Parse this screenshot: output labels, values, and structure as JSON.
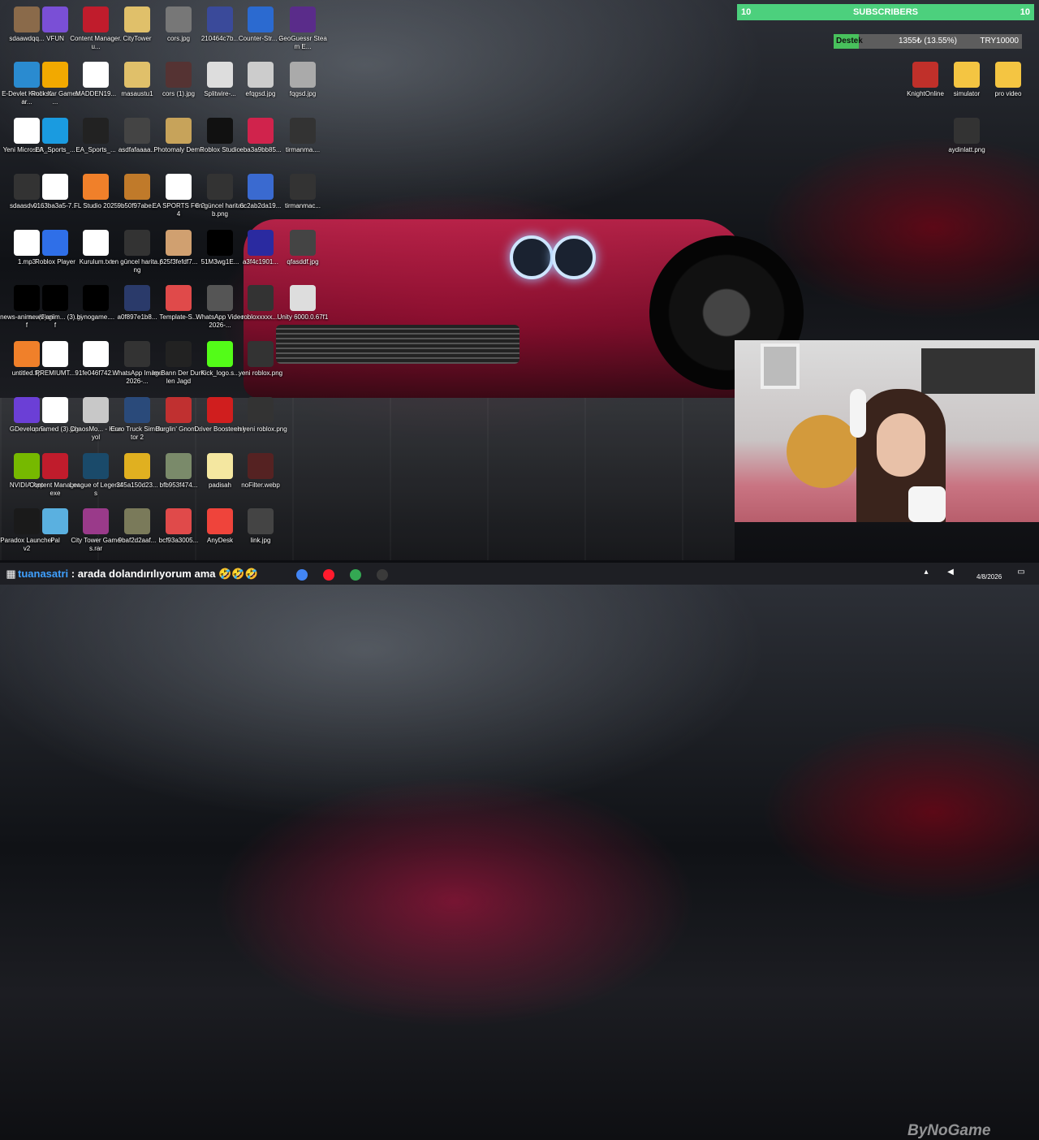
{
  "desktop": {
    "icons": [
      {
        "label": "sdaawdqq...",
        "icon": "image-thumb-icon",
        "color": "#8a6a4a"
      },
      {
        "label": "VFUN",
        "icon": "vfun-cubes-icon",
        "color": "#7a4fd6"
      },
      {
        "label": "Content Manager.u...",
        "icon": "content-manager-icon",
        "color": "#c01c2c"
      },
      {
        "label": "CityTower",
        "icon": "folder-zip-icon",
        "color": "#e0c06a"
      },
      {
        "label": "cors.jpg",
        "icon": "image-thumb-icon",
        "color": "#777777"
      },
      {
        "label": "210464c7b...",
        "icon": "image-thumb-icon",
        "color": "#3a4a9a"
      },
      {
        "label": "Counter-Str... 2",
        "icon": "counter-strike-icon",
        "color": "#2b6ad0"
      },
      {
        "label": "GeoGuessr Steam E...",
        "icon": "geoguessr-pin-icon",
        "color": "#5a2c8a"
      },
      {
        "label": "E-Devlet Kimlik Kar...",
        "icon": "edevlet-icon",
        "color": "#2a8bd0"
      },
      {
        "label": "Rockstar Games ...",
        "icon": "rockstar-icon",
        "color": "#f2a900"
      },
      {
        "label": "MADDEN19...",
        "icon": "image-file-icon",
        "color": "#ffffff"
      },
      {
        "label": "masaustu1",
        "icon": "folder-zip-icon",
        "color": "#e0c06a"
      },
      {
        "label": "cors (1).jpg",
        "icon": "image-thumb-icon",
        "color": "#553333"
      },
      {
        "label": "Splitwire-...",
        "icon": "splitwire-icon",
        "color": "#dddddd"
      },
      {
        "label": "efqgsd.jpg",
        "icon": "image-thumb-icon",
        "color": "#cccccc"
      },
      {
        "label": "fqgsd.jpg",
        "icon": "image-thumb-icon",
        "color": "#aaaaaa"
      },
      {
        "label": "Yeni Microsoft ...",
        "icon": "docx-file-icon",
        "color": "#ffffff"
      },
      {
        "label": "EA_Sports_...",
        "icon": "edge-browser-icon",
        "color": "#1a9be0"
      },
      {
        "label": "EA_Sports_...",
        "icon": "ea-sports-icon",
        "color": "#222222"
      },
      {
        "label": "asdfafaaaa...",
        "icon": "image-thumb-icon",
        "color": "#444444"
      },
      {
        "label": "Photomaly Demo",
        "icon": "photomaly-icon",
        "color": "#c7a35a"
      },
      {
        "label": "Roblox Studio",
        "icon": "roblox-studio-icon",
        "color": "#111111"
      },
      {
        "label": "eba3a9bb85...",
        "icon": "rose-image-icon",
        "color": "#d0234c"
      },
      {
        "label": "tirmanma....",
        "icon": "image-thumb-icon",
        "color": "#333333"
      },
      {
        "label": "sdaasdvv....",
        "icon": "image-thumb-icon",
        "color": "#333333"
      },
      {
        "label": "0163ba3a5-7...",
        "icon": "image-file-icon",
        "color": "#ffffff"
      },
      {
        "label": "FL Studio 2025",
        "icon": "fl-studio-icon",
        "color": "#f0802a"
      },
      {
        "label": "9b50f97abe...",
        "icon": "image-thumb-icon",
        "color": "#c07a2a"
      },
      {
        "label": "EA SPORTS FC 24",
        "icon": "ea-fc-icon",
        "color": "#ffffff"
      },
      {
        "label": "en güncel haritasb.png",
        "icon": "image-thumb-icon",
        "color": "#333333"
      },
      {
        "label": "6c2ab2da19...",
        "icon": "cap-image-icon",
        "color": "#3a6ad0"
      },
      {
        "label": "tirmanmac...",
        "icon": "image-thumb-icon",
        "color": "#333333"
      },
      {
        "label": "1.mp3",
        "icon": "media-file-icon",
        "color": "#ffffff"
      },
      {
        "label": "Roblox Player",
        "icon": "roblox-player-icon",
        "color": "#2f6fe8"
      },
      {
        "label": "Kurulum.txt",
        "icon": "text-file-icon",
        "color": "#ffffff"
      },
      {
        "label": "en güncel harita.png",
        "icon": "image-thumb-icon",
        "color": "#333333"
      },
      {
        "label": "625f3fefdf7...",
        "icon": "image-thumb-icon",
        "color": "#d0a070"
      },
      {
        "label": "51M3wg1E...",
        "icon": "image-thumb-icon",
        "color": "#000000"
      },
      {
        "label": "a3f4c1901...",
        "icon": "image-thumb-icon",
        "color": "#2a2aa0"
      },
      {
        "label": "qfasddf.jpg",
        "icon": "image-thumb-icon",
        "color": "#444444"
      },
      {
        "label": "news-anim... (2).gif",
        "icon": "gif-thumb-icon",
        "color": "#000000"
      },
      {
        "label": "news-anim... (3).gif",
        "icon": "gif-thumb-icon",
        "color": "#000000"
      },
      {
        "label": "bynogame....",
        "icon": "image-thumb-icon",
        "color": "#000000"
      },
      {
        "label": "a0f897e1b8...",
        "icon": "image-thumb-icon",
        "color": "#2a3a6a"
      },
      {
        "label": "Template-S...",
        "icon": "template-grid-icon",
        "color": "#e04a4a"
      },
      {
        "label": "WhatsApp Video 2026-...",
        "icon": "video-thumb-icon",
        "color": "#555555"
      },
      {
        "label": "robloxxxxx....",
        "icon": "image-thumb-icon",
        "color": "#333333"
      },
      {
        "label": "Unity 6000.0.67f1",
        "icon": "unity-icon",
        "color": "#dddddd"
      },
      {
        "label": "untitled.flp",
        "icon": "fl-studio-icon",
        "color": "#f0802a"
      },
      {
        "label": "PREMIUMT...",
        "icon": "text-file-icon",
        "color": "#ffffff"
      },
      {
        "label": "91fe046f742...",
        "icon": "image-file-icon",
        "color": "#ffffff"
      },
      {
        "label": "WhatsApp Image 2026-...",
        "icon": "image-thumb-icon",
        "color": "#333333"
      },
      {
        "label": "Im Bann Der Dunklen Jagd",
        "icon": "game-icon",
        "color": "#222222"
      },
      {
        "label": "Kick_logo.s...",
        "icon": "kick-logo-icon",
        "color": "#53fc18"
      },
      {
        "label": "yeni roblox.png",
        "icon": "image-thumb-icon",
        "color": "#333333"
      },
      {
        "label": "GDevelop 5",
        "icon": "gdevelop-icon",
        "color": "#6b3fd6"
      },
      {
        "label": "unnamed (3).jpg",
        "icon": "image-file-icon",
        "color": "#ffffff"
      },
      {
        "label": "ChaosMo... - Kisayol",
        "icon": "gta-icon",
        "color": "#c8c8c8"
      },
      {
        "label": "Euro Truck Simulator 2",
        "icon": "truck-icon",
        "color": "#2a4a7a"
      },
      {
        "label": "Burglin' Gnom...",
        "icon": "game-icon",
        "color": "#c03030"
      },
      {
        "label": "Driver Booster.lnk",
        "icon": "driver-booster-icon",
        "color": "#d01e1e"
      },
      {
        "label": "en yeni roblox.png",
        "icon": "image-thumb-icon",
        "color": "#333333"
      },
      {
        "label": "NVIDIA App",
        "icon": "nvidia-icon",
        "color": "#76b900"
      },
      {
        "label": "Content Manager.exe",
        "icon": "content-manager-icon",
        "color": "#c01c2c"
      },
      {
        "label": "League of Legends",
        "icon": "league-icon",
        "color": "#1a4a6a"
      },
      {
        "label": "345a150d23...",
        "icon": "image-thumb-icon",
        "color": "#e0b020"
      },
      {
        "label": "bfb953f474...",
        "icon": "image-thumb-icon",
        "color": "#7a8a6a"
      },
      {
        "label": "padisah",
        "icon": "text-file-icon",
        "color": "#f4e7a0"
      },
      {
        "label": "noFilter.webp",
        "icon": "image-thumb-icon",
        "color": "#552222"
      },
      {
        "label": "Paradox Launcher v2",
        "icon": "paradox-icon",
        "color": "#1a1a1a"
      },
      {
        "label": "Pal",
        "icon": "pal-icon",
        "color": "#5ab0e0"
      },
      {
        "label": "City Tower Games.rar",
        "icon": "winrar-icon",
        "color": "#9a3a8a"
      },
      {
        "label": "9baf2d2aaf...",
        "icon": "image-thumb-icon",
        "color": "#7a7a5a"
      },
      {
        "label": "bcf93a3005...",
        "icon": "template-grid-icon",
        "color": "#e04a4a"
      },
      {
        "label": "AnyDesk",
        "icon": "anydesk-icon",
        "color": "#ef443b"
      },
      {
        "label": "link.jpg",
        "icon": "image-thumb-icon",
        "color": "#444444"
      },
      {
        "label": "KnightOnline",
        "icon": "knight-online-icon",
        "color": "#c0302a"
      },
      {
        "label": "simulator",
        "icon": "folder-icon",
        "color": "#f4c542"
      },
      {
        "label": "pro video",
        "icon": "folder-icon",
        "color": "#f4c542"
      },
      {
        "label": "aydinlatt.png",
        "icon": "image-thumb-icon",
        "color": "#333333"
      }
    ]
  },
  "overlay": {
    "subscribers": {
      "left_count": "10",
      "title": "SUBSCRIBERS",
      "right_count": "10",
      "color": "#4cd07d"
    },
    "donation": {
      "label": "Destek",
      "progress_text": "1355₺ (13.55%)",
      "goal": "TRY10000",
      "progress_fraction": 0.1355
    }
  },
  "taskbar": {
    "chat_user": "tuanasatri",
    "chat_message": ": arada dolandırılıyorum ama",
    "chat_emojis": "🤣🤣🤣",
    "date": "4/8/2026",
    "watermark": "ByNoGame",
    "apps": [
      {
        "name": "chrome-icon",
        "color": "#4285f4"
      },
      {
        "name": "opera-icon",
        "color": "#ff1b2d"
      },
      {
        "name": "chrome-profile-icon",
        "color": "#34a853"
      },
      {
        "name": "obs-icon",
        "color": "#3a3a3a"
      }
    ]
  }
}
